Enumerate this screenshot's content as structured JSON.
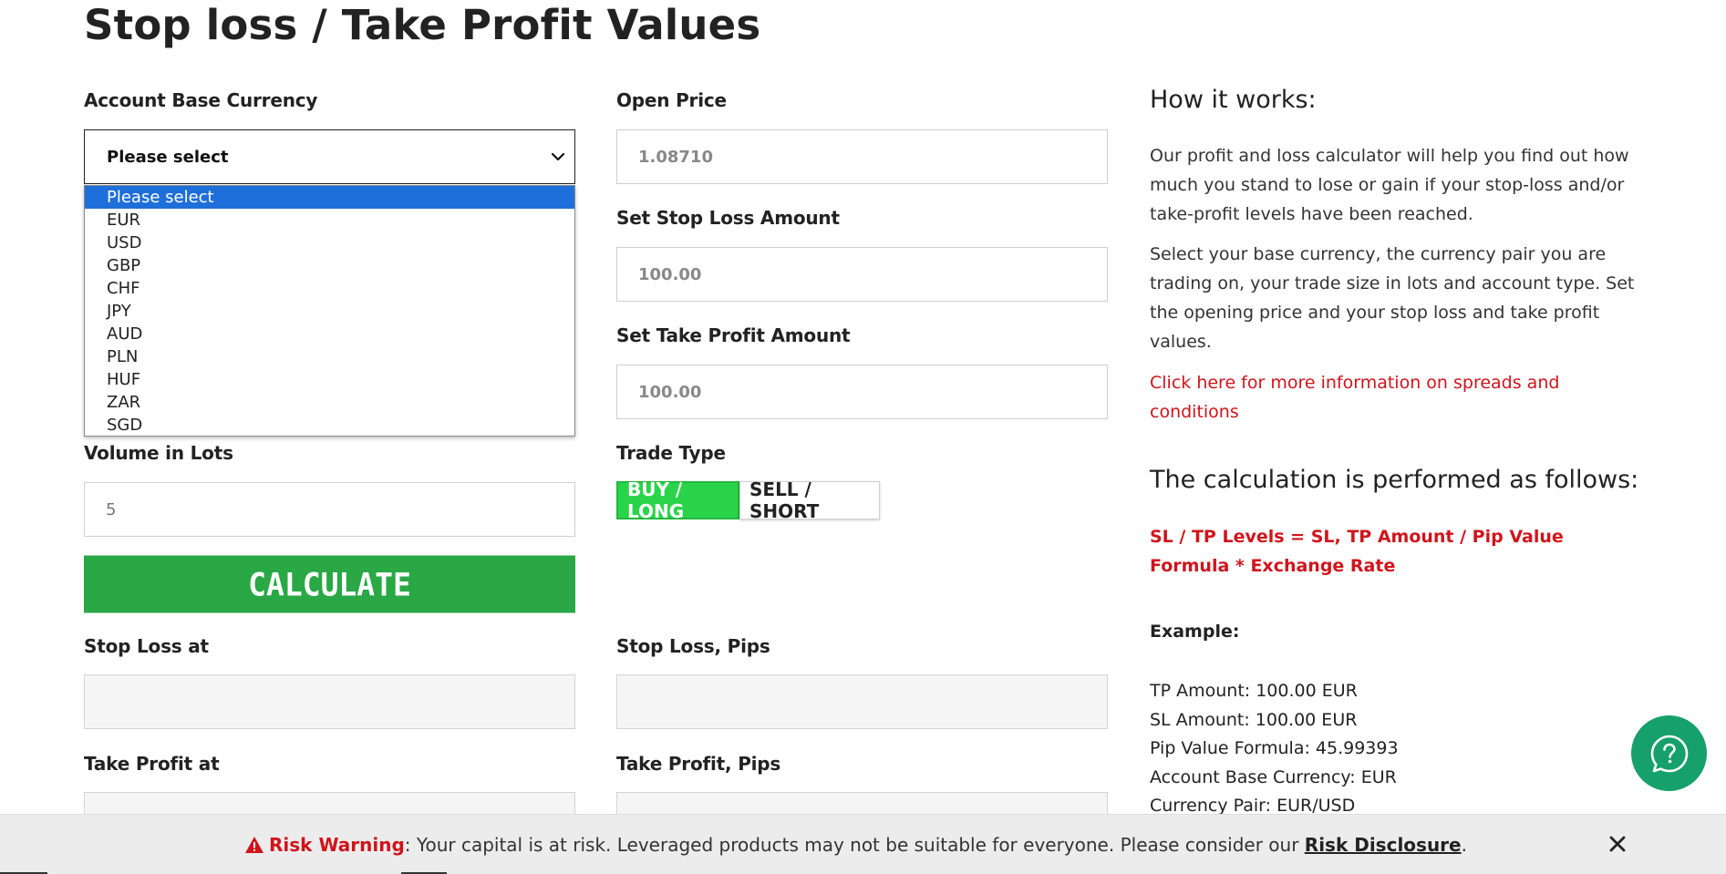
{
  "page": {
    "title": "Stop loss / Take Profit Values"
  },
  "form": {
    "account_base_currency": {
      "label": "Account Base Currency",
      "selected": "Please select",
      "options": [
        "Please select",
        "EUR",
        "USD",
        "GBP",
        "CHF",
        "JPY",
        "AUD",
        "PLN",
        "HUF",
        "ZAR",
        "SGD"
      ]
    },
    "open_price": {
      "label": "Open Price",
      "placeholder": "1.08710"
    },
    "stop_loss_amount": {
      "label": "Set Stop Loss Amount",
      "placeholder": "100.00"
    },
    "take_profit_amount": {
      "label": "Set Take Profit Amount",
      "placeholder": "100.00"
    },
    "volume": {
      "label": "Volume in Lots",
      "placeholder": "5"
    },
    "trade_type": {
      "label": "Trade Type",
      "buy_label": "BUY / LONG",
      "sell_label": "SELL / SHORT",
      "active": "BUY / LONG"
    },
    "calculate_label": "CALCULATE",
    "results": {
      "stop_loss_at": "Stop Loss at",
      "stop_loss_pips": "Stop Loss, Pips",
      "take_profit_at": "Take Profit at",
      "take_profit_pips": "Take Profit, Pips"
    }
  },
  "info": {
    "how_title": "How it works:",
    "para1": "Our profit and loss calculator will help you find out how much you stand to lose or gain if your stop-loss and/or take-profit levels have been reached.",
    "para2": "Select your base currency,  the currency pair you are trading on, your trade size in lots and account type. Set the opening price and your stop loss and take profit values.",
    "link": "Click here for more information on spreads and conditions",
    "calc_title": "The calculation is performed as follows:",
    "formula": "SL / TP Levels = SL, TP Amount / Pip Value Formula * Exchange Rate",
    "example_title": "Example:",
    "example_lines": [
      "TP Amount: 100.00 EUR",
      "SL Amount: 100.00 EUR",
      "Pip Value Formula: 45.99393",
      "Account Base Currency: EUR",
      "Currency Pair: EUR/USD"
    ]
  },
  "risk_bar": {
    "label": "Risk Warning",
    "text": ": Your capital is at risk. Leveraged products may not be suitable for everyone. Please consider our ",
    "link": "Risk Disclosure",
    "end": "."
  },
  "colors": {
    "accent_green": "#29a845",
    "buy_green": "#2ad44a",
    "link_red": "#d0141b",
    "help_teal": "#16a06b",
    "select_blue": "#1e6fd9"
  }
}
